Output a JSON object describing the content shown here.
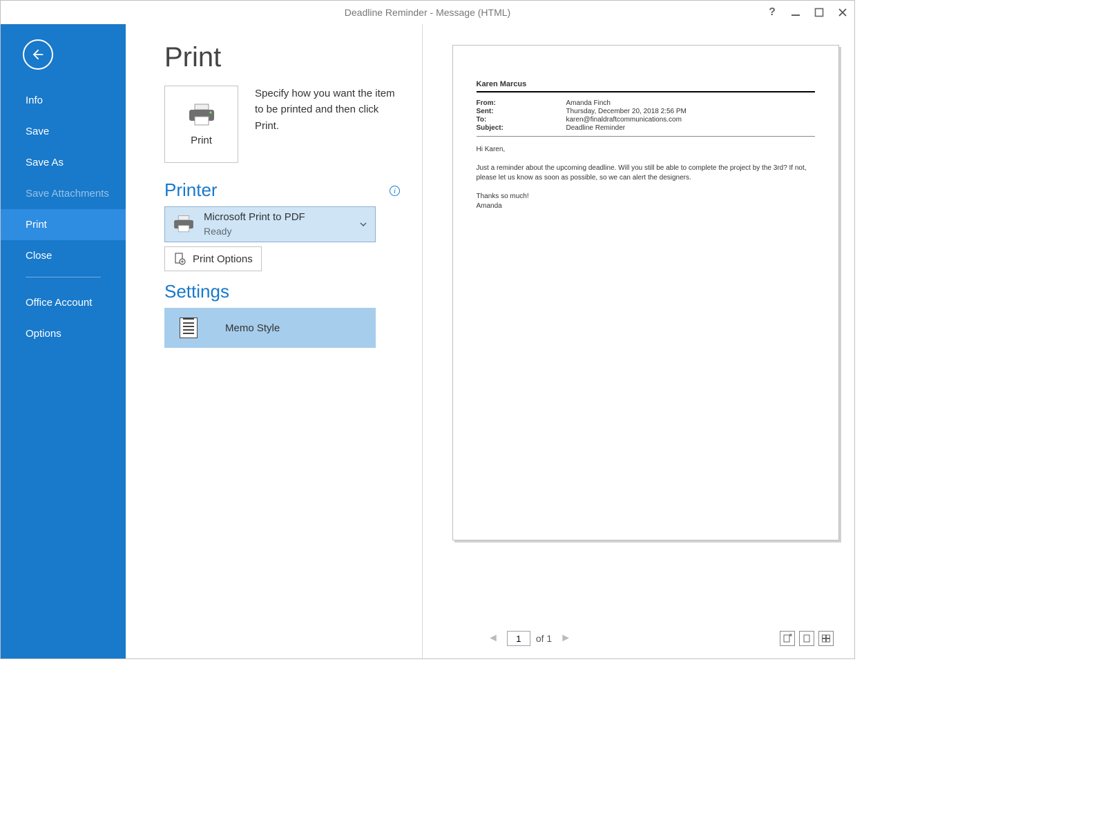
{
  "window": {
    "title": "Deadline Reminder - Message (HTML)"
  },
  "sidebar": {
    "items": [
      {
        "label": "Info"
      },
      {
        "label": "Save"
      },
      {
        "label": "Save As"
      },
      {
        "label": "Save Attachments"
      },
      {
        "label": "Print"
      },
      {
        "label": "Close"
      },
      {
        "label": "Office Account"
      },
      {
        "label": "Options"
      }
    ]
  },
  "main": {
    "page_title": "Print",
    "print_button_label": "Print",
    "description": "Specify how you want the item to be printed and then click Print.",
    "printer_heading": "Printer",
    "printer": {
      "name": "Microsoft Print to PDF",
      "status": "Ready"
    },
    "print_options_label": "Print Options",
    "settings_heading": "Settings",
    "style_label": "Memo Style"
  },
  "preview": {
    "user": "Karen Marcus",
    "from_label": "From:",
    "from_value": "Amanda Finch",
    "sent_label": "Sent:",
    "sent_value": "Thursday, December 20, 2018 2:56 PM",
    "to_label": "To:",
    "to_value": "karen@finaldraftcommunications.com",
    "subject_label": "Subject:",
    "subject_value": "Deadline Reminder",
    "greeting": "Hi Karen,",
    "body": "Just a reminder about the upcoming deadline. Will you still be able to complete the project by the 3rd? If not, please let us know as soon as possible, so we can alert the designers.",
    "thanks": "Thanks so much!",
    "signature": "Amanda"
  },
  "pager": {
    "current": "1",
    "of_label": "of 1"
  }
}
